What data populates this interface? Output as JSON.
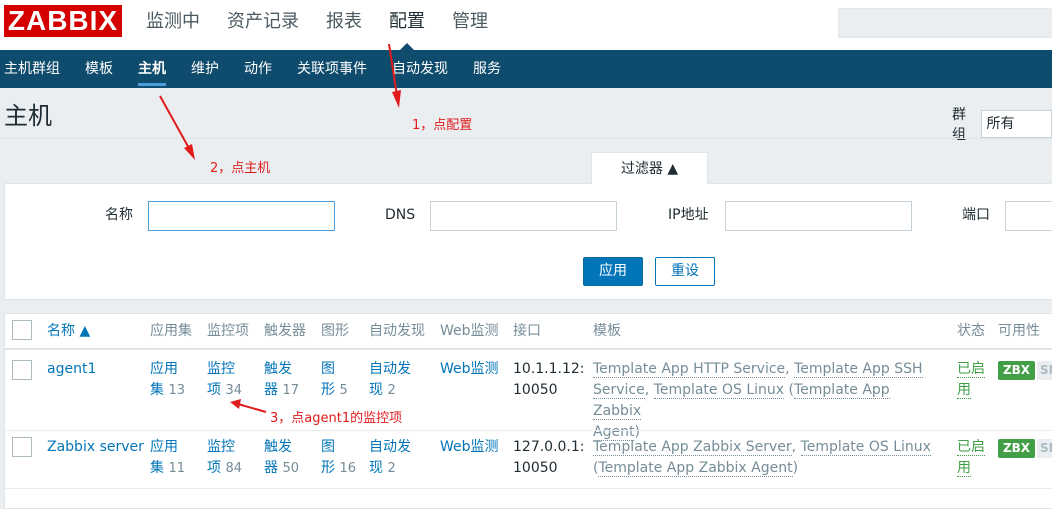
{
  "header": {
    "logo": "ZABBIX",
    "menu": [
      "监测中",
      "资产记录",
      "报表",
      "配置",
      "管理"
    ],
    "active_menu_index": 3
  },
  "submenu": {
    "items": [
      "主机群组",
      "模板",
      "主机",
      "维护",
      "动作",
      "关联项事件",
      "自动发现",
      "服务"
    ],
    "active_index": 2
  },
  "page": {
    "title": "主机",
    "group_label": "群组",
    "group_value": "所有"
  },
  "filter": {
    "tab_label": "过滤器 ▲",
    "name_label": "名称",
    "dns_label": "DNS",
    "ip_label": "IP地址",
    "port_label": "端口",
    "apply_label": "应用",
    "reset_label": "重设"
  },
  "table": {
    "columns": [
      "名称 ▲",
      "应用集",
      "监控项",
      "触发器",
      "图形",
      "自动发现",
      "Web监测",
      "接口",
      "模板",
      "状态",
      "可用性"
    ],
    "rows": [
      {
        "name": "agent1",
        "apps_label": [
          "应用",
          "集"
        ],
        "apps_count": "13",
        "items_label": [
          "监控",
          "项"
        ],
        "items_count": "34",
        "triggers_label": [
          "触发",
          "器"
        ],
        "triggers_count": "17",
        "graphs_label": [
          "图",
          "形"
        ],
        "graphs_count": "5",
        "discovery_label": [
          "自动发",
          "现"
        ],
        "discovery_count": "2",
        "web": "Web监测",
        "interface": [
          "10.1.1.12:",
          "10050"
        ],
        "templates": {
          "t1": "Template App HTTP Service",
          "t2": "Template App SSH",
          "t2b": "Service",
          "t3": "Template OS Linux",
          "parent1": "Template App Zabbix",
          "parent2": "Agent"
        },
        "status": [
          "已启",
          "用"
        ],
        "zbx": "ZBX",
        "snmp": "SNMP"
      },
      {
        "name": "Zabbix server",
        "apps_label": [
          "应用",
          "集"
        ],
        "apps_count": "11",
        "items_label": [
          "监控",
          "项"
        ],
        "items_count": "84",
        "triggers_label": [
          "触发",
          "器"
        ],
        "triggers_count": "50",
        "graphs_label": [
          "图",
          "形"
        ],
        "graphs_count": "16",
        "discovery_label": [
          "自动发",
          "现"
        ],
        "discovery_count": "2",
        "web": "Web监测",
        "interface": [
          "127.0.0.1:",
          "10050"
        ],
        "templates": {
          "t1": "Template App Zabbix Server",
          "t2": "Template OS Linux",
          "parent1": "Template App Zabbix Agent"
        },
        "status": [
          "已启",
          "用"
        ],
        "zbx": "ZBX",
        "snmp": "SNMP"
      }
    ]
  },
  "annotations": {
    "a1": "1，点配置",
    "a2": "2，点主机",
    "a3": "3，点agent1的监控项",
    "color": "#e01b1b"
  }
}
